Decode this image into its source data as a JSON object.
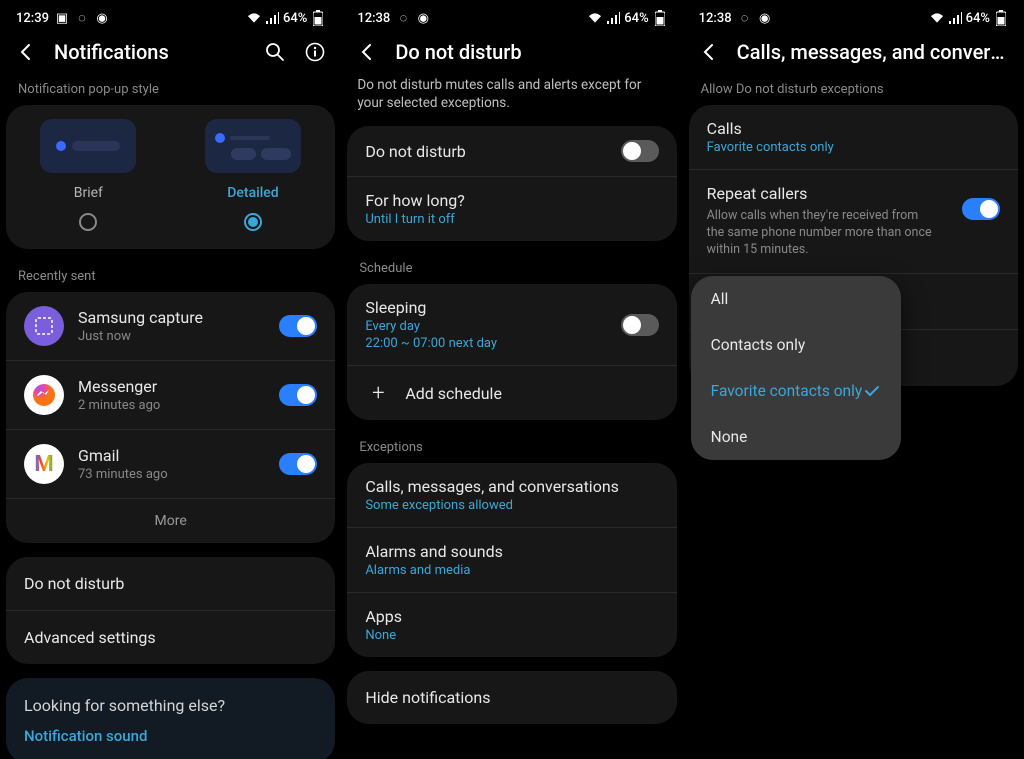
{
  "panel1": {
    "status": {
      "time": "12:39",
      "battery": "64%"
    },
    "title": "Notifications",
    "popup_section": "Notification pop-up style",
    "popup_options": {
      "brief": "Brief",
      "detailed": "Detailed"
    },
    "recently_sent": "Recently sent",
    "apps": [
      {
        "name": "Samsung capture",
        "time": "Just now"
      },
      {
        "name": "Messenger",
        "time": "2 minutes ago"
      },
      {
        "name": "Gmail",
        "time": "73 minutes ago"
      }
    ],
    "more": "More",
    "settings": {
      "dnd": "Do not disturb",
      "advanced": "Advanced settings"
    },
    "footer": {
      "question": "Looking for something else?",
      "link": "Notification sound"
    }
  },
  "panel2": {
    "status": {
      "time": "12:38",
      "battery": "64%"
    },
    "title": "Do not disturb",
    "description": "Do not disturb mutes calls and alerts except for your selected exceptions.",
    "dnd_toggle": "Do not disturb",
    "how_long": {
      "title": "For how long?",
      "value": "Until I turn it off"
    },
    "schedule_label": "Schedule",
    "schedule": {
      "name": "Sleeping",
      "days": "Every day",
      "time": "22:00 ~ 07:00 next day"
    },
    "add_schedule": "Add schedule",
    "exceptions_label": "Exceptions",
    "exceptions": {
      "calls": {
        "title": "Calls, messages, and conversations",
        "sub": "Some exceptions allowed"
      },
      "alarms": {
        "title": "Alarms and sounds",
        "sub": "Alarms and media"
      },
      "apps": {
        "title": "Apps",
        "sub": "None"
      }
    },
    "hide": "Hide notifications"
  },
  "panel3": {
    "status": {
      "time": "12:38",
      "battery": "64%"
    },
    "title": "Calls, messages, and conversa…",
    "section": "Allow Do not disturb exceptions",
    "calls": {
      "title": "Calls",
      "sub": "Favorite contacts only"
    },
    "repeat": {
      "title": "Repeat callers",
      "desc": "Allow calls when they're received from the same phone number more than once within 15 minutes."
    },
    "menu": {
      "all": "All",
      "contacts": "Contacts only",
      "favorite": "Favorite contacts only",
      "none": "None"
    }
  }
}
